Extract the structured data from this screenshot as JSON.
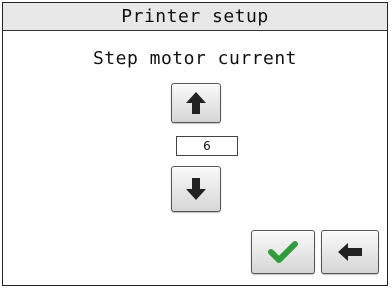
{
  "title": "Printer setup",
  "setting_label": "Step motor current",
  "value": "6",
  "icons": {
    "up": "arrow-up-icon",
    "down": "arrow-down-icon",
    "confirm": "checkmark-icon",
    "back": "arrow-left-icon"
  },
  "colors": {
    "title_bar_bg": "#e8e8e8",
    "confirm_icon": "#2e9e3a",
    "arrow_icon": "#222222"
  }
}
